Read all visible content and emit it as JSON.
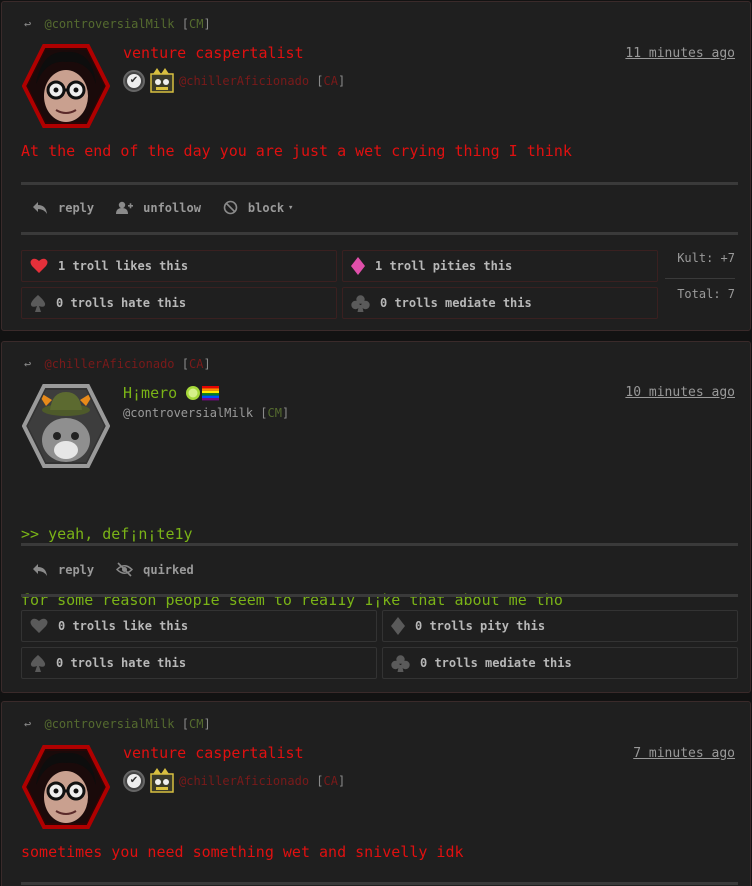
{
  "posts": [
    {
      "reply_to_handle": "@controversialMilk",
      "reply_to_tag": "CM",
      "display_name": "venture caspertalist",
      "author_handle": "@chillerAficionado",
      "author_tag": "CA",
      "timestamp": "11 minutes ago",
      "body": "At the end of the day you are just a wet crying thing I think",
      "actions": [
        "reply",
        "unfollow",
        "block"
      ],
      "reactions": {
        "like": "1 troll likes this",
        "pity": "1 troll pities this",
        "hate": "0 trolls hate this",
        "mediate": "0 trolls mediate this"
      },
      "kult": "Kult: +7",
      "total": "Total: 7"
    },
    {
      "reply_to_handle": "@chillerAficionado",
      "reply_to_tag": "CA",
      "display_name": "H¡mero",
      "author_handle": "@controversialMilk",
      "author_tag": "CM",
      "timestamp": "10 minutes ago",
      "body_lines": [
        ">> yeah, def¡n¡te1y",
        "for some reason peop1e seem to rea11y 1¡ke that about me tho"
      ],
      "actions": [
        "reply",
        "quirked"
      ],
      "reactions": {
        "like": "0 trolls like this",
        "pity": "0 trolls pity this",
        "hate": "0 trolls hate this",
        "mediate": "0 trolls mediate this"
      }
    },
    {
      "reply_to_handle": "@controversialMilk",
      "reply_to_tag": "CM",
      "display_name": "venture caspertalist",
      "author_handle": "@chillerAficionado",
      "author_tag": "CA",
      "timestamp": "7 minutes ago",
      "body": "sometimes you need something wet and snivelly idk"
    }
  ],
  "colors": {
    "red_text": "#e01010",
    "green_text": "#7ab317",
    "background": "#1f1f1f",
    "heart": "#e5303a",
    "diamond": "#e04faa"
  },
  "icons": {
    "reply": "reply-arrow-icon",
    "unfollow": "user-minus-icon",
    "block": "block-circle-icon",
    "quirked": "eye-slash-icon",
    "like": "heart-icon",
    "pity": "diamond-icon",
    "hate": "spade-icon",
    "mediate": "club-icon"
  }
}
